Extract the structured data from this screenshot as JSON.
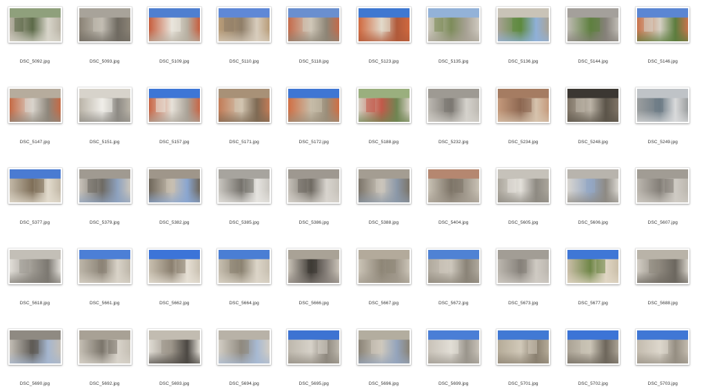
{
  "files": [
    {
      "name": "DSC_5092.jpg",
      "palette": [
        "#8fa07c",
        "#b9b3a5",
        "#5c6a48",
        "#d8d5ca"
      ]
    },
    {
      "name": "DSC_5093.jpg",
      "palette": [
        "#a8a39a",
        "#8a8275",
        "#c2bdb3",
        "#6f6a61"
      ]
    },
    {
      "name": "DSC_5109.jpg",
      "palette": [
        "#4f7fd0",
        "#c65d3d",
        "#e9e5dc",
        "#b7b0a2"
      ]
    },
    {
      "name": "DSC_5110.jpg",
      "palette": [
        "#5f88d6",
        "#b89c78",
        "#8f7e68",
        "#d8cdbd"
      ]
    },
    {
      "name": "DSC_5118.jpg",
      "palette": [
        "#6a8fcf",
        "#c46a4a",
        "#cfc7b8",
        "#8d8576"
      ]
    },
    {
      "name": "DSC_5123.jpg",
      "palette": [
        "#3f78d1",
        "#d0683e",
        "#e2dacb",
        "#b05a3a"
      ]
    },
    {
      "name": "DSC_5135.jpg",
      "palette": [
        "#93b2d8",
        "#cfcac0",
        "#7d8c5a",
        "#a8a295"
      ]
    },
    {
      "name": "DSC_5136.jpg",
      "palette": [
        "#c9c3b7",
        "#aaa396",
        "#5e8a3f",
        "#8fb0d8"
      ]
    },
    {
      "name": "DSC_5144.jpg",
      "palette": [
        "#a4a09b",
        "#c0bcb5",
        "#5f8040",
        "#86817a"
      ]
    },
    {
      "name": "DSC_5146.jpg",
      "palette": [
        "#5b86d3",
        "#c9744d",
        "#d6d0c4",
        "#5c7d3e"
      ]
    },
    {
      "name": "DSC_5147.jpg",
      "palette": [
        "#b6ac9d",
        "#c56a45",
        "#d9d4cc",
        "#8e877c"
      ]
    },
    {
      "name": "DSC_5151.jpg",
      "palette": [
        "#d7d3cb",
        "#bab4a8",
        "#f0eee9",
        "#8d8a84"
      ]
    },
    {
      "name": "DSC_5157.jpg",
      "palette": [
        "#3d76d6",
        "#c86545",
        "#e7e2d9",
        "#aaa398"
      ]
    },
    {
      "name": "DSC_5171.jpg",
      "palette": [
        "#a89177",
        "#c27b56",
        "#d1c4b0",
        "#7e6a54"
      ]
    },
    {
      "name": "DSC_5172.jpg",
      "palette": [
        "#3f76d3",
        "#d06e43",
        "#c7bda9",
        "#9a8e7a"
      ]
    },
    {
      "name": "DSC_5188.jpg",
      "palette": [
        "#9aaf7e",
        "#d6d0c3",
        "#c25a4a",
        "#6f8552"
      ]
    },
    {
      "name": "DSC_5232.jpg",
      "palette": [
        "#9e9a93",
        "#bdb9b2",
        "#7c7872",
        "#d5d2cc"
      ]
    },
    {
      "name": "DSC_5234.jpg",
      "palette": [
        "#a57c62",
        "#c59a7c",
        "#8c6650",
        "#d6c3ad"
      ]
    },
    {
      "name": "DSC_5248.jpg",
      "palette": [
        "#3b3732",
        "#7e7365",
        "#bcb4a7",
        "#5b5449"
      ]
    },
    {
      "name": "DSC_5249.jpg",
      "palette": [
        "#bfc3c7",
        "#9b9e9f",
        "#6e7c86",
        "#d9dadb"
      ]
    },
    {
      "name": "DSC_5377.jpg",
      "palette": [
        "#4a7bd2",
        "#c2b8a7",
        "#7e6e58",
        "#e2dbcd"
      ]
    },
    {
      "name": "DSC_5379.jpg",
      "palette": [
        "#a09a91",
        "#c9c4bb",
        "#6e6a63",
        "#8ea2bf"
      ]
    },
    {
      "name": "DSC_5382.jpg",
      "palette": [
        "#9f968a",
        "#6e665a",
        "#c8bfb1",
        "#8aa6d0"
      ]
    },
    {
      "name": "DSC_5385.jpg",
      "palette": [
        "#a7a49e",
        "#c9c6c0",
        "#75726c",
        "#e6e4e0"
      ]
    },
    {
      "name": "DSC_5386.jpg",
      "palette": [
        "#9e9890",
        "#c6c1b9",
        "#6f6a62",
        "#d8d4ce"
      ]
    },
    {
      "name": "DSC_5388.jpg",
      "palette": [
        "#a49d92",
        "#7b7469",
        "#cbc5bb",
        "#8b98a8"
      ]
    },
    {
      "name": "DSC_5404.jpg",
      "palette": [
        "#b58770",
        "#c9c2b5",
        "#7d7467",
        "#a39b8f"
      ]
    },
    {
      "name": "DSC_5605.jpg",
      "palette": [
        "#c6c2ba",
        "#aaa59b",
        "#e3e0da",
        "#8e8a82"
      ]
    },
    {
      "name": "DSC_5606.jpg",
      "palette": [
        "#b8b4ad",
        "#d9d6d0",
        "#94a7c4",
        "#8e8a83"
      ]
    },
    {
      "name": "DSC_5607.jpg",
      "palette": [
        "#a19c94",
        "#bcb7af",
        "#837e77",
        "#cfcbc4"
      ]
    },
    {
      "name": "DSC_5618.jpg",
      "palette": [
        "#c3bfb7",
        "#e1ded8",
        "#9d9991",
        "#7c7871"
      ]
    },
    {
      "name": "DSC_5661.jpg",
      "palette": [
        "#4c7fd6",
        "#bdb6a9",
        "#8c8477",
        "#d9d3c8"
      ]
    },
    {
      "name": "DSC_5662.jpg",
      "palette": [
        "#3c74d8",
        "#c9c0b0",
        "#8a7f6f",
        "#e6e0d5"
      ]
    },
    {
      "name": "DSC_5664.jpg",
      "palette": [
        "#4a7ed4",
        "#c7bfb0",
        "#8b8271",
        "#dcd5c8"
      ]
    },
    {
      "name": "DSC_5666.jpg",
      "palette": [
        "#a9a296",
        "#c9c2b7",
        "#3e3a35",
        "#87807a"
      ]
    },
    {
      "name": "DSC_5667.jpg",
      "palette": [
        "#b3aa9b",
        "#cbc4b7",
        "#8e8677",
        "#a0988b"
      ]
    },
    {
      "name": "DSC_5672.jpg",
      "palette": [
        "#4f82d4",
        "#b0a99d",
        "#cdc7bc",
        "#8a8377"
      ]
    },
    {
      "name": "DSC_5673.jpg",
      "palette": [
        "#a29d95",
        "#bcb7af",
        "#86817a",
        "#cfcac3"
      ]
    },
    {
      "name": "DSC_5677.jpg",
      "palette": [
        "#3f77d6",
        "#cbbfa9",
        "#6f8647",
        "#e0d6c4"
      ]
    },
    {
      "name": "DSC_5688.jpg",
      "palette": [
        "#b9b3a8",
        "#d3cec5",
        "#8c867c",
        "#6c675f"
      ]
    },
    {
      "name": "DSC_5690.jpg",
      "palette": [
        "#8f8a82",
        "#c3beb6",
        "#5f5b55",
        "#a5b6cf"
      ]
    },
    {
      "name": "DSC_5692.jpg",
      "palette": [
        "#a8a195",
        "#c5bfb4",
        "#7b756b",
        "#d8d3ca"
      ]
    },
    {
      "name": "DSC_5693.jpg",
      "palette": [
        "#c2bcb1",
        "#e0dcd4",
        "#9a9388",
        "#4c4843"
      ]
    },
    {
      "name": "DSC_5694.jpg",
      "palette": [
        "#b8b2a7",
        "#d2cdc4",
        "#908a80",
        "#a7b9d2"
      ]
    },
    {
      "name": "DSC_5695.jpg",
      "palette": [
        "#3d73d2",
        "#bdb7ac",
        "#d7d2c9",
        "#8e887e"
      ]
    },
    {
      "name": "DSC_5696.jpg",
      "palette": [
        "#b3ad9f",
        "#8a8376",
        "#cfc9bd",
        "#94a4bc"
      ]
    },
    {
      "name": "DSC_5699.jpg",
      "palette": [
        "#4a7ed6",
        "#c8c2b8",
        "#e2ded6",
        "#9a958c"
      ]
    },
    {
      "name": "DSC_5701.jpg",
      "palette": [
        "#4179d4",
        "#b5ab98",
        "#d1c9b9",
        "#8a8070"
      ]
    },
    {
      "name": "DSC_5702.jpg",
      "palette": [
        "#3c74d6",
        "#aaa294",
        "#cbc4b6",
        "#6d665b"
      ]
    },
    {
      "name": "DSC_5703.jpg",
      "palette": [
        "#4077d5",
        "#c3bbae",
        "#ddd7cc",
        "#958e82"
      ]
    }
  ]
}
